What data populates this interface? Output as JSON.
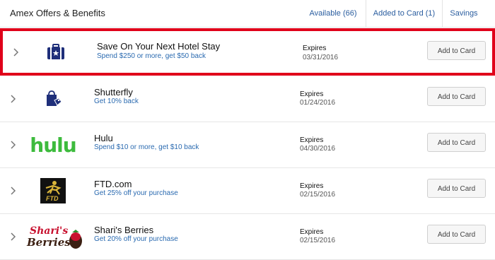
{
  "header": {
    "title": "Amex Offers & Benefits",
    "tabs": [
      {
        "label": "Available (66)"
      },
      {
        "label": "Added to Card (1)"
      },
      {
        "label": "Savings"
      }
    ]
  },
  "offers": [
    {
      "title": "Save On Your Next Hotel Stay",
      "subtitle": "Spend $250 or more, get $50 back",
      "expires_label": "Expires",
      "expires": "03/31/2016",
      "button": "Add to Card",
      "logo": "suitcase-icon"
    },
    {
      "title": "Shutterfly",
      "subtitle": "Get 10% back",
      "expires_label": "Expires",
      "expires": "01/24/2016",
      "button": "Add to Card",
      "logo": "shopping-bag-icon"
    },
    {
      "title": "Hulu",
      "subtitle": "Spend $10 or more, get $10 back",
      "expires_label": "Expires",
      "expires": "04/30/2016",
      "button": "Add to Card",
      "logo": "hulu-logo",
      "logo_text": "hulu"
    },
    {
      "title": "FTD.com",
      "subtitle": "Get 25% off your purchase",
      "expires_label": "Expires",
      "expires": "02/15/2016",
      "button": "Add to Card",
      "logo": "ftd-logo",
      "logo_text": "FTD"
    },
    {
      "title": "Shari's Berries",
      "subtitle": "Get 20% off your purchase",
      "expires_label": "Expires",
      "expires": "02/15/2016",
      "button": "Add to Card",
      "logo": "sharis-berries-logo",
      "logo_text": "Shari's Berries"
    }
  ],
  "colors": {
    "highlight": "#e0001a",
    "link": "#2a5d9f",
    "hulu": "#3dbb3d",
    "amex_navy": "#1f2f7a"
  }
}
